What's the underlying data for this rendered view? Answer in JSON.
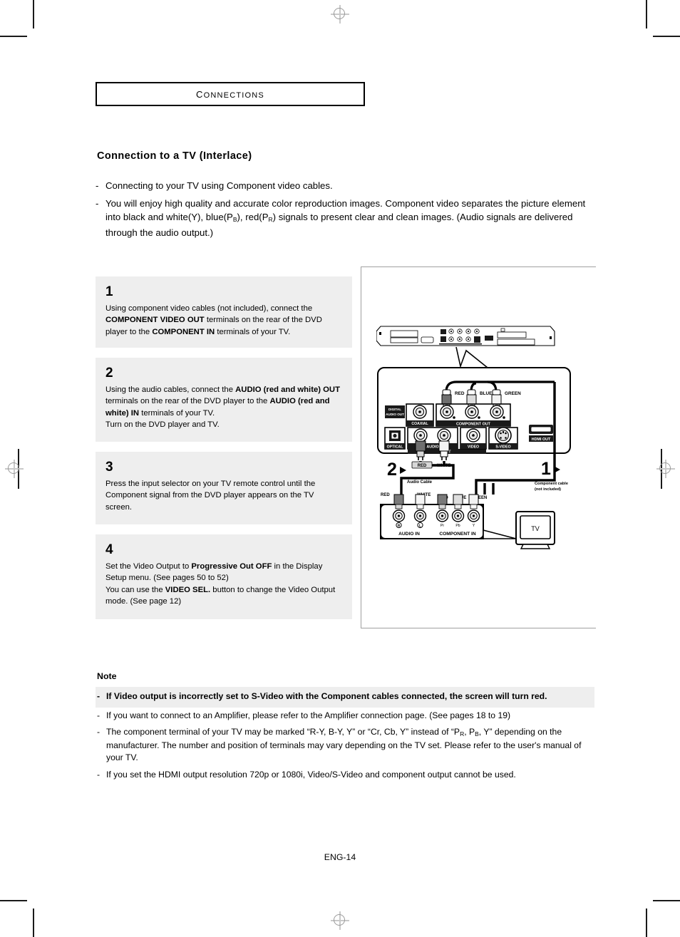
{
  "chapter": {
    "title": "Connections"
  },
  "section": {
    "heading": "Connection to a TV (Interlace)"
  },
  "intro": {
    "dash": "-",
    "bullets": [
      "Connecting to your TV using Component video cables.",
      "You will enjoy high quality and accurate color reproduction images. Component video separates the picture element into black and white(Y), blue(PB), red(PR) signals to present clear and clean images. (Audio signals are delivered through the audio output.)"
    ]
  },
  "steps": [
    {
      "number": "1",
      "text_parts": [
        {
          "t": "Using component video cables (not included), connect the ",
          "b": false
        },
        {
          "t": "COMPONENT VIDEO OUT",
          "b": true
        },
        {
          "t": " terminals on the rear of the DVD player to the ",
          "b": false
        },
        {
          "t": "COMPONENT IN",
          "b": true
        },
        {
          "t": " terminals of your TV.",
          "b": false
        }
      ]
    },
    {
      "number": "2",
      "text_parts": [
        {
          "t": "Using the audio cables, connect the ",
          "b": false
        },
        {
          "t": "AUDIO (red and white) OUT",
          "b": true
        },
        {
          "t": " terminals on the rear of the DVD player to the ",
          "b": false
        },
        {
          "t": "AUDIO (red and white) IN",
          "b": true
        },
        {
          "t": " terminals of your TV.",
          "b": false
        },
        {
          "t": "\nTurn on the DVD player and TV.",
          "b": false
        }
      ]
    },
    {
      "number": "3",
      "text_parts": [
        {
          "t": "Press the input selector on your TV remote control until the Component signal from the DVD player appears on the TV screen.",
          "b": false
        }
      ]
    },
    {
      "number": "4",
      "text_parts": [
        {
          "t": "Set the Video Output to ",
          "b": false
        },
        {
          "t": "Progressive Out OFF",
          "b": true
        },
        {
          "t": " in the Display Setup menu. (See pages 50 to 52)",
          "b": false
        },
        {
          "t": "\nYou can use the ",
          "b": false
        },
        {
          "t": "VIDEO SEL.",
          "b": true
        },
        {
          "t": " button to change the Video Output mode. (See page 12)",
          "b": false
        }
      ]
    }
  ],
  "diagram": {
    "player_panel": {
      "digital_audio_out": "DIGITAL AUDIO OUT",
      "coaxial": "COAXIAL",
      "optical": "OPTICAL",
      "component_out": "COMPONENT OUT",
      "audio": "AUDIO",
      "out": "OUT",
      "video": "VIDEO",
      "s_video": "S-VIDEO",
      "hdmi_out": "HDMI OUT"
    },
    "component_cable_colors": [
      "RED",
      "BLUE",
      "GREEN"
    ],
    "audio_cable_colors": [
      "RED",
      "WHITE"
    ],
    "tv_panel": {
      "audio_in": "AUDIO IN",
      "component_in": "COMPONENT IN",
      "audio_jacks": [
        "R",
        "L"
      ],
      "component_jacks": [
        "Pr",
        "Pb",
        "Y"
      ],
      "component_in_colors": [
        "RED",
        "BLUE",
        "GREEN"
      ],
      "audio_in_colors": [
        "RED",
        "WHITE"
      ]
    },
    "callouts": [
      {
        "number": "1",
        "label": "Component cable\n(not included)"
      },
      {
        "number": "2",
        "label": "Audio Cable"
      }
    ],
    "tv_label": "TV"
  },
  "note": {
    "label": "Note",
    "dash": "-",
    "items": [
      {
        "text": "If Video output is incorrectly set to S-Video with the Component cables connected, the screen will turn red.",
        "highlight": true
      },
      {
        "text": "If you want to connect to an Amplifier, please refer to the Amplifier connection page. (See pages 18 to 19)",
        "highlight": false
      },
      {
        "text": "The component terminal of your TV may be marked “R-Y, B-Y, Y” or “Cr, Cb, Y” instead of “PR, PB, Y” depending on the manufacturer. The number and position of terminals may vary depending on the TV set. Please refer to the user's manual of your TV.",
        "highlight": false
      },
      {
        "text": "If you set the HDMI output resolution 720p or 1080i, Video/S-Video and component output cannot be used.",
        "highlight": false
      }
    ]
  },
  "footer": {
    "page": "ENG-14"
  },
  "colors": {
    "box_background": "#eeeeee",
    "rule": "#a0a0a0",
    "text": "#000000"
  }
}
